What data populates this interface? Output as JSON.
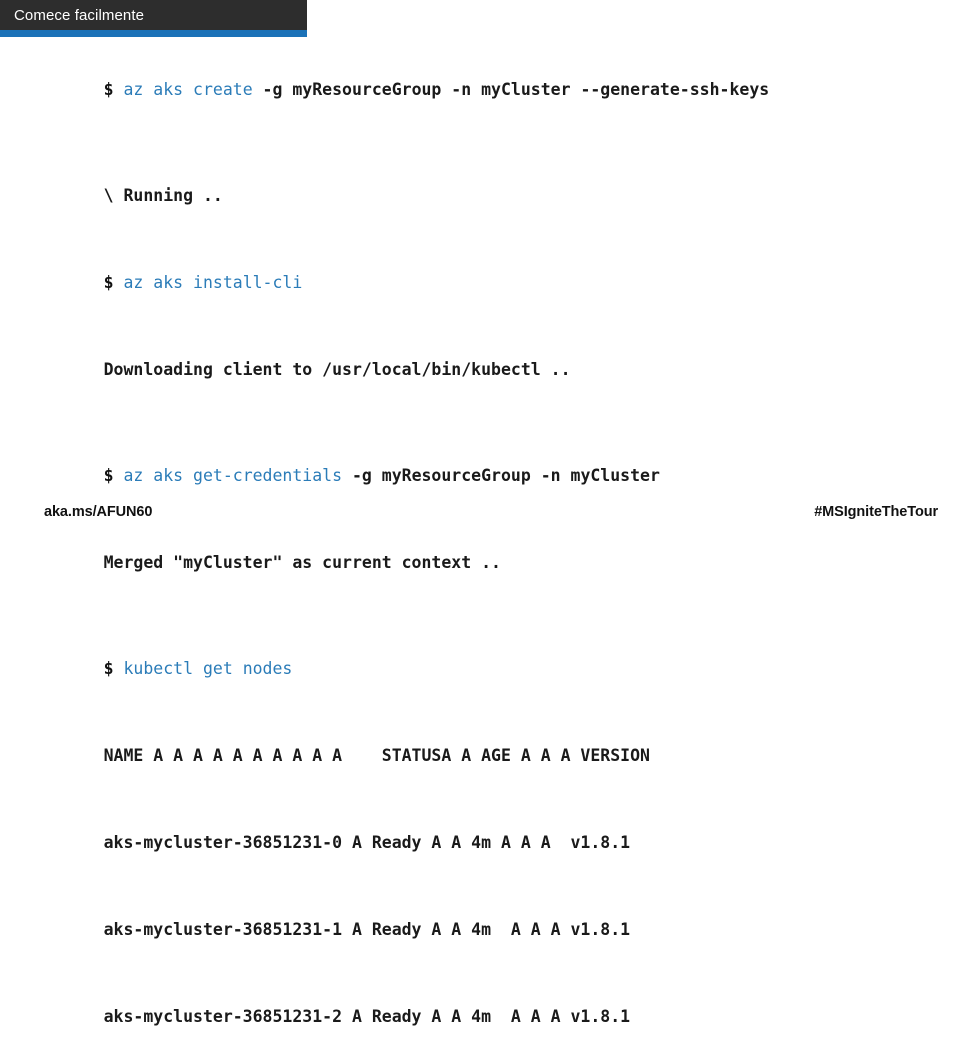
{
  "slide": {
    "title": "Comece facilmente",
    "accent_color": "#1b72b8",
    "banner_color": "#2d2d2d",
    "command_color": "#2b7cb8",
    "text_color": "#1a1a1a",
    "background_color": "#ffffff"
  },
  "terminal": {
    "lines": [
      {
        "id": "line-create",
        "prompt": "$ ",
        "command": "az aks create",
        "args": " -g myResourceGroup -n myCluster --generate-ssh-keys",
        "output": ""
      },
      {
        "id": "line-running",
        "prompt": "",
        "command": "",
        "args": "",
        "output": "\\ Running .."
      },
      {
        "id": "line-install-cli",
        "prompt": "$ ",
        "command": "az aks install-cli",
        "args": "",
        "output": ""
      },
      {
        "id": "line-downloading",
        "prompt": "",
        "command": "",
        "args": "",
        "output": "Downloading client to /usr/local/bin/kubectl .."
      },
      {
        "id": "line-get-credentials",
        "prompt": "$ ",
        "command": "az aks get-credentials",
        "args": " -g myResourceGroup -n myCluster",
        "output": ""
      },
      {
        "id": "line-merged",
        "prompt": "",
        "command": "",
        "args": "",
        "output": "Merged \"myCluster\" as current context .."
      },
      {
        "id": "line-get-nodes",
        "prompt": "$ ",
        "command": "kubectl get nodes",
        "args": "",
        "output": ""
      },
      {
        "id": "line-nodes-header",
        "prompt": "",
        "command": "",
        "args": "",
        "output": "NAME A A A A A A A A A A    STATUSA A AGE A A A VERSION"
      },
      {
        "id": "line-node-0",
        "prompt": "",
        "command": "",
        "args": "",
        "output": "aks-mycluster-36851231-0 A Ready A A 4m A A A  v1.8.1"
      },
      {
        "id": "line-node-1",
        "prompt": "",
        "command": "",
        "args": "",
        "output": "aks-mycluster-36851231-1 A Ready A A 4m  A A A v1.8.1"
      },
      {
        "id": "line-node-2",
        "prompt": "",
        "command": "",
        "args": "",
        "output": "aks-mycluster-36851231-2 A Ready A A 4m  A A A v1.8.1"
      }
    ]
  },
  "footer": {
    "link": "aka.ms/AFUN60",
    "hashtag": "#MSIgniteTheTour"
  }
}
